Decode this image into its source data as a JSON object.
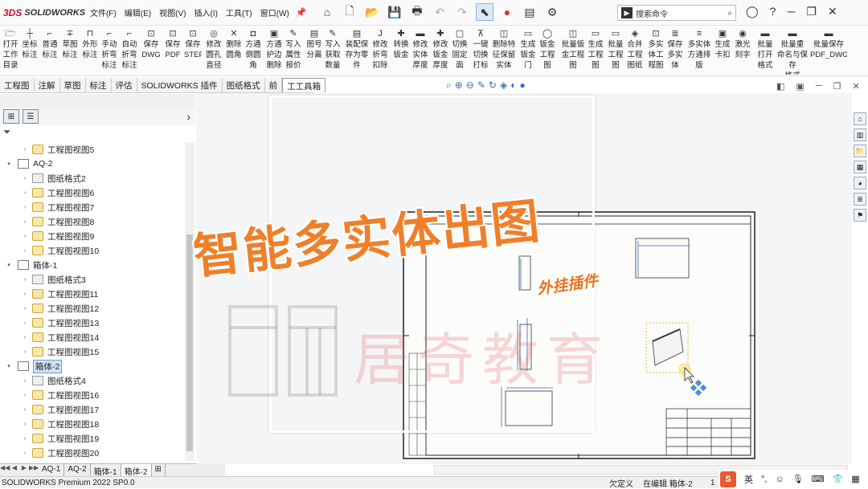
{
  "app": {
    "brand_prefix": "3DS",
    "brand": "SOLIDWORKS"
  },
  "menu": [
    "文件(F)",
    "编辑(E)",
    "视图(V)",
    "插入(I)",
    "工具(T)",
    "窗口(W)"
  ],
  "search": {
    "prefix": "▶",
    "placeholder": "搜索命令"
  },
  "ribbon": [
    {
      "l1": "打开",
      "l2": "工作",
      "l3": "目录"
    },
    {
      "l1": "坐标",
      "l2": "标注",
      "l3": ""
    },
    {
      "l1": "普通",
      "l2": "标注",
      "l3": ""
    },
    {
      "l1": "草图",
      "l2": "标注",
      "l3": ""
    },
    {
      "l1": "外形",
      "l2": "标注",
      "l3": ""
    },
    {
      "l1": "手动",
      "l2": "折弯",
      "l3": "标注"
    },
    {
      "l1": "自动",
      "l2": "折弯",
      "l3": "标注"
    },
    {
      "l1": "保存",
      "l2": "DWG",
      "l3": ""
    },
    {
      "l1": "保存",
      "l2": "PDF",
      "l3": ""
    },
    {
      "l1": "保存",
      "l2": "STEP",
      "l3": ""
    },
    {
      "l1": "修改",
      "l2": "圆孔",
      "l3": "直径"
    },
    {
      "l1": "删除",
      "l2": "圆角",
      "l3": ""
    },
    {
      "l1": "方通",
      "l2": "倒圆",
      "l3": "角"
    },
    {
      "l1": "方通",
      "l2": "护边",
      "l3": "删除"
    },
    {
      "l1": "写入",
      "l2": "属性",
      "l3": "报价"
    },
    {
      "l1": "图号",
      "l2": "分离",
      "l3": ""
    },
    {
      "l1": "写入",
      "l2": "获取",
      "l3": "数量"
    },
    {
      "l1": "装配保",
      "l2": "存为零",
      "l3": "件"
    },
    {
      "l1": "修改",
      "l2": "折弯",
      "l3": "扣除"
    },
    {
      "l1": "转换",
      "l2": "钣金",
      "l3": ""
    },
    {
      "l1": "修改",
      "l2": "实体",
      "l3": "厚度"
    },
    {
      "l1": "修改",
      "l2": "钣金",
      "l3": "厚度"
    },
    {
      "l1": "切换",
      "l2": "固定",
      "l3": "面"
    },
    {
      "l1": "一键",
      "l2": "切换",
      "l3": "打标"
    },
    {
      "l1": "删除特",
      "l2": "征保留",
      "l3": "实体"
    },
    {
      "l1": "生成",
      "l2": "钣金",
      "l3": "门"
    },
    {
      "l1": "钣金",
      "l2": "工程",
      "l3": "图"
    },
    {
      "l1": "批量钣",
      "l2": "金工程",
      "l3": "图"
    },
    {
      "l1": "生成",
      "l2": "工程",
      "l3": "图"
    },
    {
      "l1": "批量",
      "l2": "工程",
      "l3": "图"
    },
    {
      "l1": "合并",
      "l2": "工程",
      "l3": "图纸"
    },
    {
      "l1": "多实",
      "l2": "体工",
      "l3": "程图"
    },
    {
      "l1": "保存",
      "l2": "多实",
      "l3": "体"
    },
    {
      "l1": "多实体",
      "l2": "方通排",
      "l3": "版"
    },
    {
      "l1": "生成",
      "l2": "卡扣",
      "l3": ""
    },
    {
      "l1": "激光",
      "l2": "刻字",
      "l3": ""
    },
    {
      "l1": "批量",
      "l2": "打开",
      "l3": "格式"
    },
    {
      "l1": "批量重",
      "l2": "命名与保存",
      "l3": "格式"
    },
    {
      "l1": "批量保存",
      "l2": "PDF_DWG",
      "l3": ""
    }
  ],
  "tabs": [
    "工程图",
    "注解",
    "草图",
    "标注",
    "评估",
    "SOLIDWORKS 插件",
    "图纸格式",
    "前",
    "工工具箱"
  ],
  "tree": [
    {
      "level": 2,
      "type": "view",
      "label": "工程图视图5"
    },
    {
      "level": 0,
      "type": "sheet",
      "label": "AQ-2",
      "open": true
    },
    {
      "level": 1,
      "type": "fmt",
      "label": "图纸格式2"
    },
    {
      "level": 1,
      "type": "view",
      "label": "工程图视图6"
    },
    {
      "level": 1,
      "type": "view",
      "label": "工程图视图7"
    },
    {
      "level": 1,
      "type": "view",
      "label": "工程图视图8"
    },
    {
      "level": 1,
      "type": "view",
      "label": "工程图视图9"
    },
    {
      "level": 1,
      "type": "view",
      "label": "工程图视图10"
    },
    {
      "level": 0,
      "type": "sheet",
      "label": "箱体-1",
      "open": true
    },
    {
      "level": 1,
      "type": "fmt",
      "label": "图纸格式3"
    },
    {
      "level": 1,
      "type": "view",
      "label": "工程图视图11"
    },
    {
      "level": 1,
      "type": "view",
      "label": "工程图视图12"
    },
    {
      "level": 1,
      "type": "view",
      "label": "工程图视图13"
    },
    {
      "level": 1,
      "type": "view",
      "label": "工程图视图14"
    },
    {
      "level": 1,
      "type": "view",
      "label": "工程图视图15"
    },
    {
      "level": 0,
      "type": "sheet",
      "label": "箱体-2",
      "open": true,
      "selected": true
    },
    {
      "level": 1,
      "type": "fmt",
      "label": "图纸格式4"
    },
    {
      "level": 1,
      "type": "view",
      "label": "工程图视图16"
    },
    {
      "level": 1,
      "type": "view",
      "label": "工程图视图17"
    },
    {
      "level": 1,
      "type": "view",
      "label": "工程图视图18"
    },
    {
      "level": 1,
      "type": "view",
      "label": "工程图视图19"
    },
    {
      "level": 1,
      "type": "view",
      "label": "工程图视图20"
    }
  ],
  "sheet_tabs": [
    "AQ-1",
    "AQ-2",
    "箱体-1",
    "箱体-2"
  ],
  "active_sheet": "箱体-2",
  "status": {
    "product": "SOLIDWORKS Premium 2022 SP0.0",
    "undefined": "欠定义",
    "editing": "在编辑 箱体-2",
    "page": "1"
  },
  "ime": {
    "logo": "S",
    "lang": "英"
  },
  "overlay": {
    "title": "智能多实体出图",
    "subtitle": "外挂插件",
    "watermark": "居奇教育"
  },
  "colors": {
    "title_orange": "#f07f2a",
    "brand_red": "#c8102e",
    "selection_blue": "#d0e2f6"
  }
}
